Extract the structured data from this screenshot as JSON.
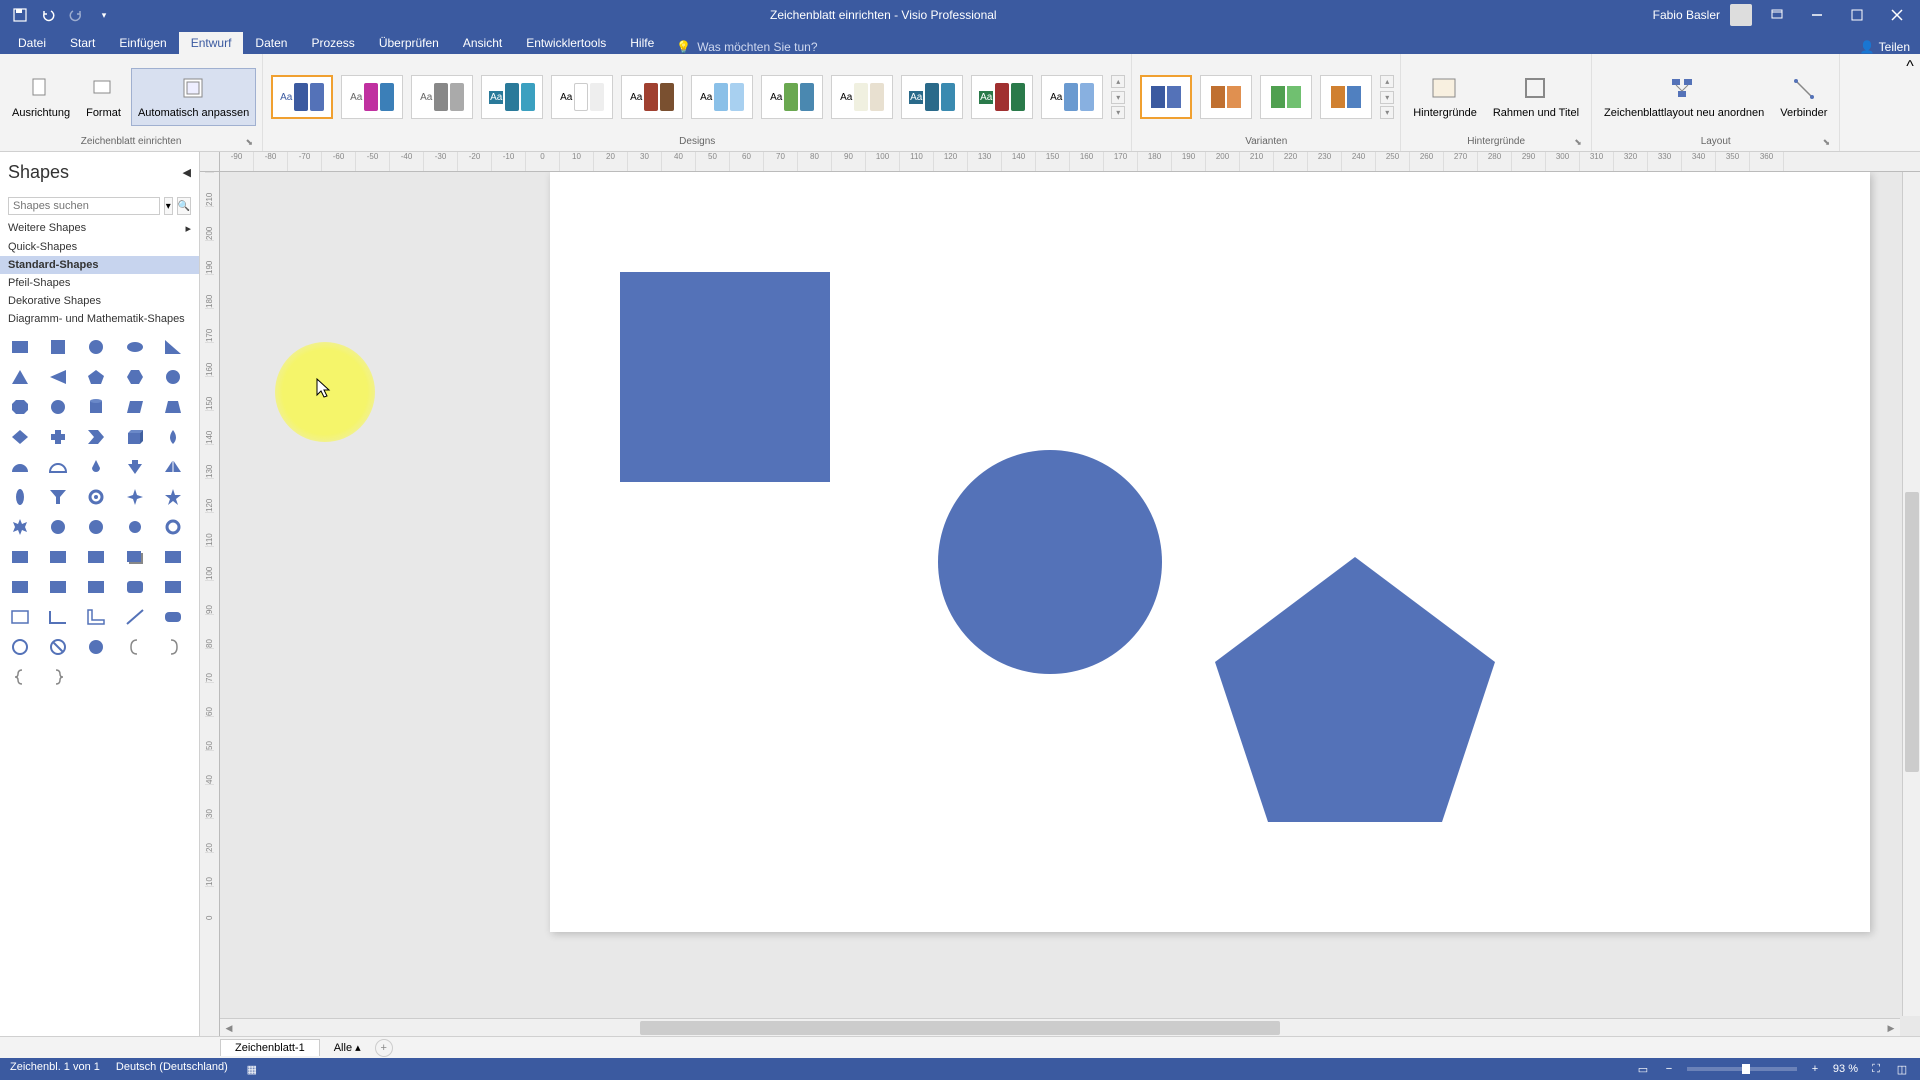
{
  "title": "Zeichenblatt einrichten - Visio Professional",
  "user": "Fabio Basler",
  "qat": {
    "save": "💾",
    "undo": "↶",
    "redo": "↷"
  },
  "tabs": [
    "Datei",
    "Start",
    "Einfügen",
    "Entwurf",
    "Daten",
    "Prozess",
    "Überprüfen",
    "Ansicht",
    "Entwicklertools",
    "Hilfe"
  ],
  "active_tab": 3,
  "tellme": "Was möchten Sie tun?",
  "share": "Teilen",
  "ribbon": {
    "group1": {
      "label": "Zeichenblatt einrichten",
      "btns": [
        "Ausrichtung",
        "Format",
        "Automatisch anpassen"
      ]
    },
    "designs_label": "Designs",
    "varianten_label": "Varianten",
    "hintergr_label": "Hintergründe",
    "layout_label": "Layout",
    "hintergr_btn": "Hintergründe",
    "rahmen_btn": "Rahmen und Titel",
    "zeichen_btn": "Zeichenblattlayout neu anordnen",
    "verbinder_btn": "Verbinder"
  },
  "shapes": {
    "title": "Shapes",
    "search_placeholder": "Shapes suchen",
    "categories": [
      "Weitere Shapes",
      "Quick-Shapes",
      "Standard-Shapes",
      "Pfeil-Shapes",
      "Dekorative Shapes",
      "Diagramm- und Mathematik-Shapes"
    ],
    "active_cat": 2
  },
  "pagetab": "Zeichenblatt-1",
  "pagetab_all": "Alle",
  "status": {
    "page": "Zeichenbl. 1 von 1",
    "lang": "Deutsch (Deutschland)",
    "zoom": "93 %"
  },
  "colors": {
    "shape_fill": "#5472b8",
    "accent": "#3b5aa0"
  },
  "ruler_h": [
    "-90",
    "-80",
    "-70",
    "-60",
    "-50",
    "-40",
    "-30",
    "-20",
    "-10",
    "0",
    "10",
    "20",
    "30",
    "40",
    "50",
    "60",
    "70",
    "80",
    "90",
    "100",
    "110",
    "120",
    "130",
    "140",
    "150",
    "160",
    "170",
    "180",
    "190",
    "200",
    "210",
    "220",
    "230",
    "240",
    "250",
    "260",
    "270",
    "280",
    "290",
    "300",
    "310",
    "320",
    "330",
    "340",
    "350",
    "360"
  ],
  "ruler_v": [
    "210",
    "200",
    "190",
    "180",
    "170",
    "160",
    "150",
    "140",
    "130",
    "120",
    "110",
    "100",
    "90",
    "80",
    "70",
    "60",
    "50",
    "40",
    "30",
    "20",
    "10",
    "0"
  ]
}
